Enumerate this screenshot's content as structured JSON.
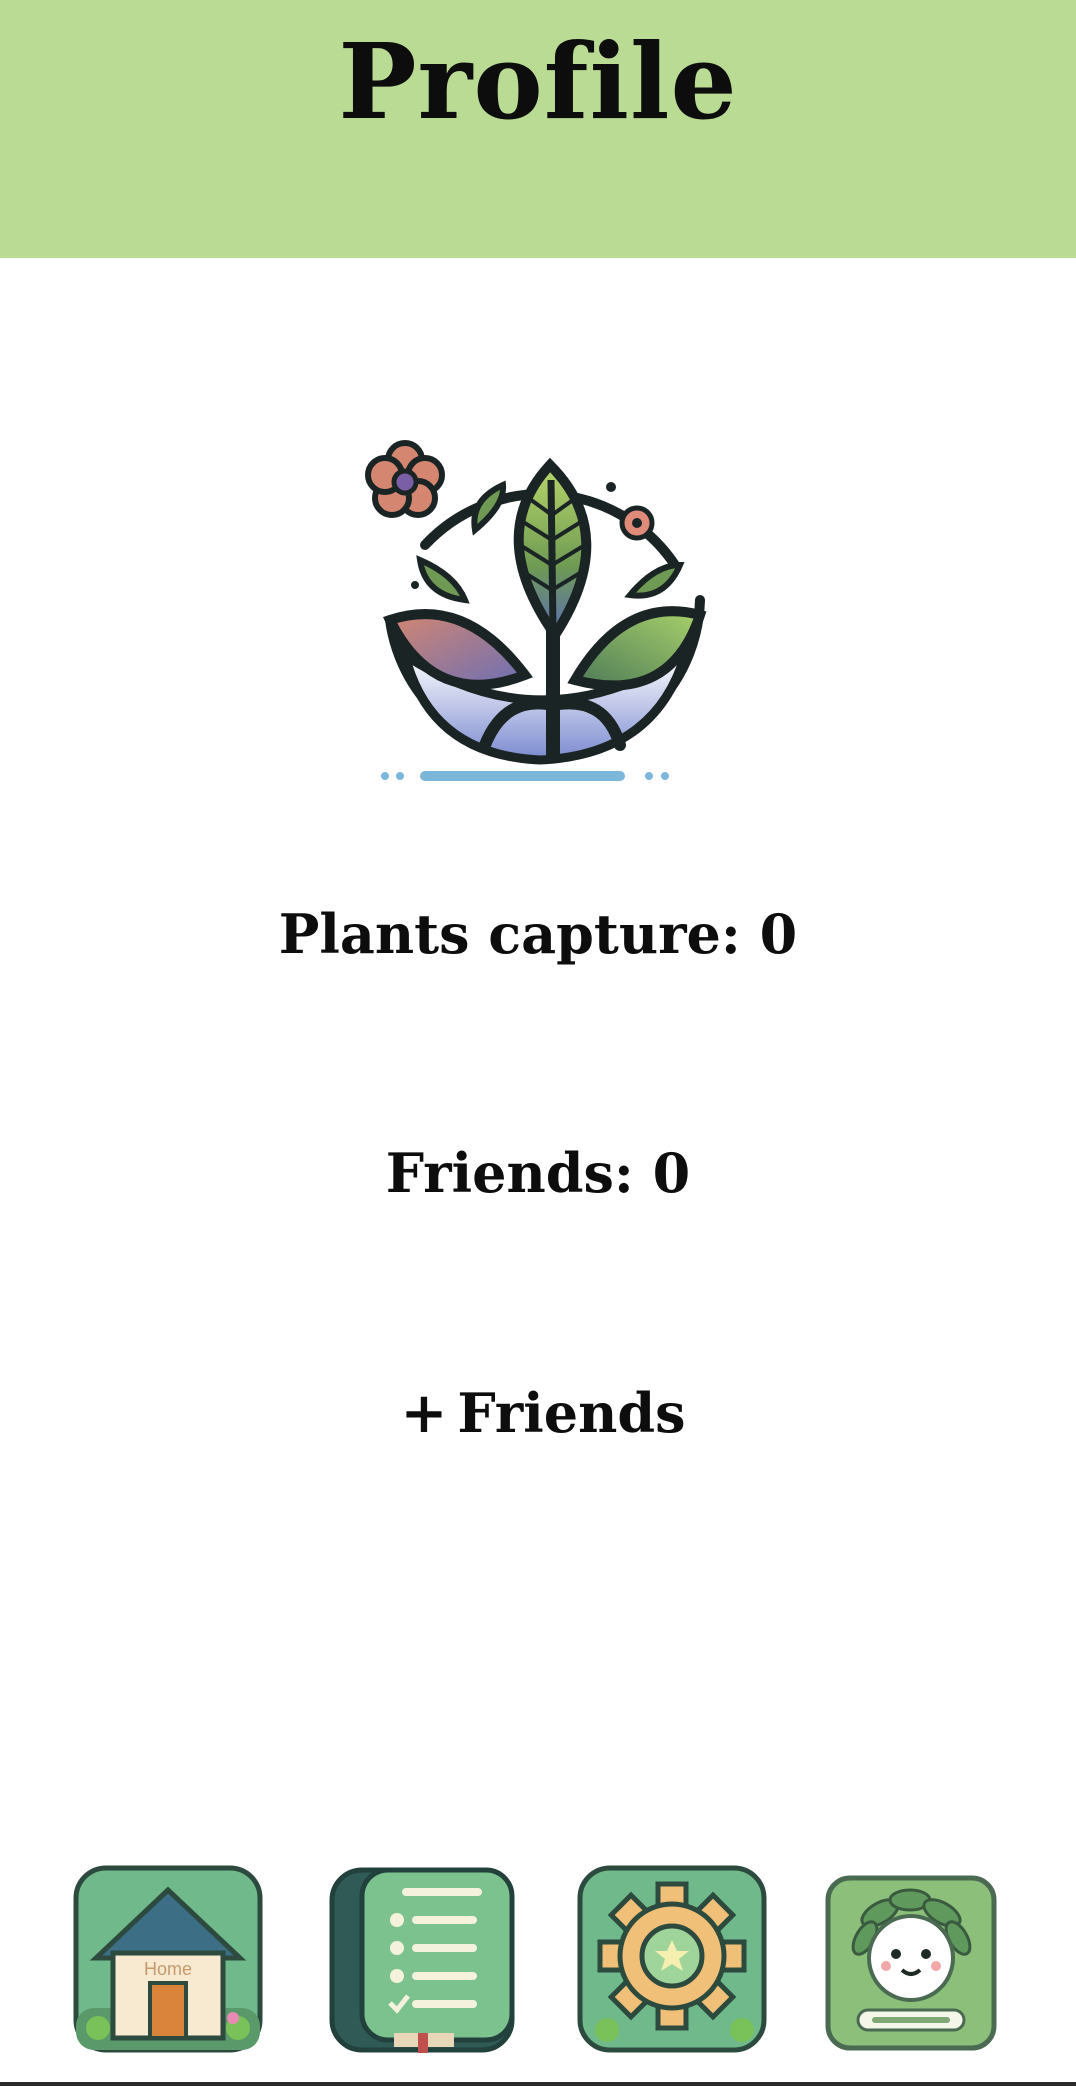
{
  "header": {
    "title": "Profile",
    "background_color": "#b9db93"
  },
  "logo": {
    "icon": "plant-logo-icon"
  },
  "stats": {
    "plants_capture": "Plants capture: 0",
    "friends": "Friends: 0"
  },
  "actions": {
    "add_friends_plus": "+",
    "add_friends_label": "Friends"
  },
  "nav": {
    "items": [
      {
        "name": "home",
        "icon": "home-icon",
        "icon_text": "Home"
      },
      {
        "name": "checklist",
        "icon": "checklist-book-icon"
      },
      {
        "name": "settings",
        "icon": "gear-icon"
      },
      {
        "name": "profile",
        "icon": "plant-avatar-icon"
      }
    ]
  }
}
